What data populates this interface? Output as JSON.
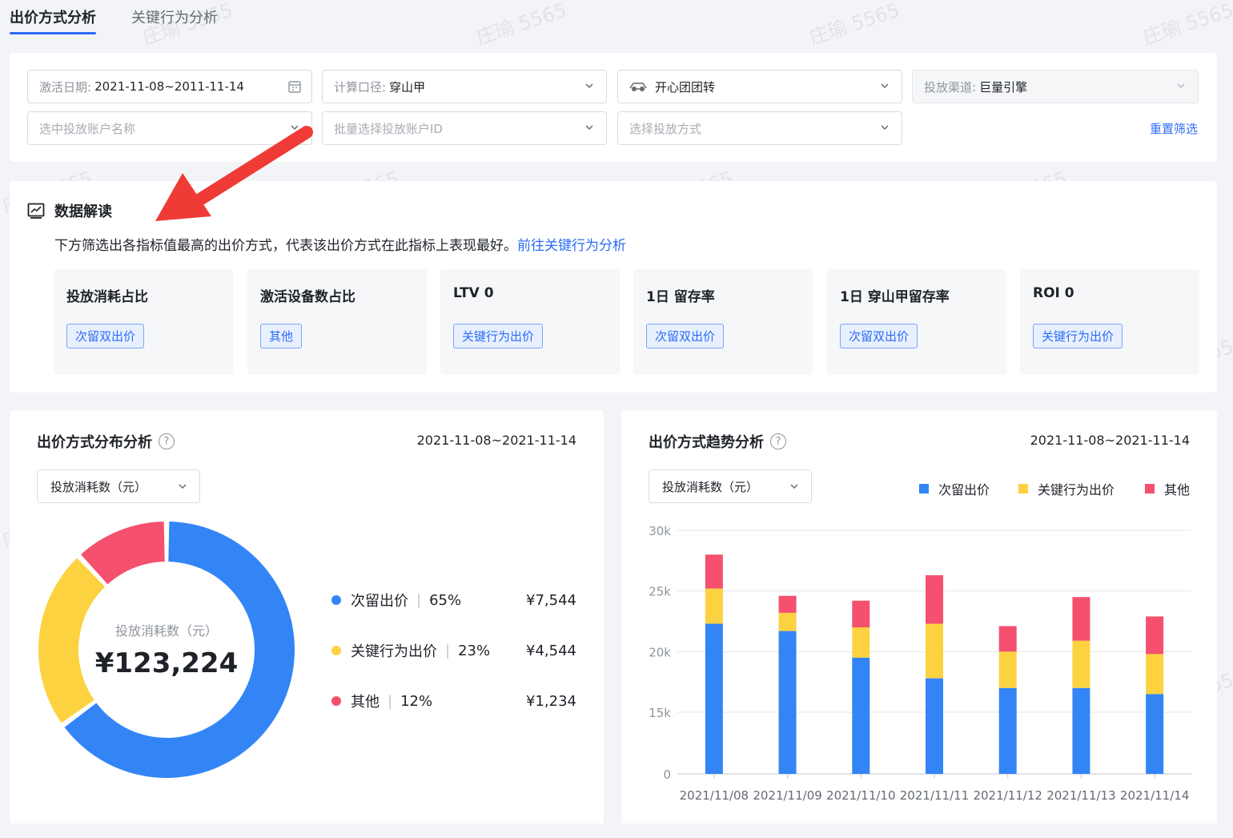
{
  "tabs": [
    {
      "label": "出价方式分析",
      "active": true
    },
    {
      "label": "关键行为分析",
      "active": false
    }
  ],
  "filters": {
    "date": {
      "label": "激活日期:",
      "value": "2021-11-08~2011-11-14"
    },
    "calc": {
      "label": "计算口径:",
      "value": "穿山甲"
    },
    "product": {
      "value": "开心团团转"
    },
    "channel": {
      "label": "投放渠道:",
      "value": "巨量引擎"
    },
    "account_name_placeholder": "选中投放账户名称",
    "account_id_placeholder": "批量选择投放账户ID",
    "bid_method_placeholder": "选择投放方式",
    "reset_label": "重置筛选"
  },
  "insight": {
    "title": "数据解读",
    "desc": "下方筛选出各指标值最高的出价方式，代表该出价方式在此指标上表现最好。",
    "link": "前往关键行为分析",
    "metrics": [
      {
        "name": "投放消耗占比",
        "tag": "次留双出价"
      },
      {
        "name": "激活设备数占比",
        "tag": "其他"
      },
      {
        "name": "LTV 0",
        "tag": "关键行为出价"
      },
      {
        "name": "1日 留存率",
        "tag": "次留双出价"
      },
      {
        "name": "1日 穿山甲留存率",
        "tag": "次留双出价"
      },
      {
        "name": "ROI 0",
        "tag": "关键行为出价"
      }
    ]
  },
  "distribution": {
    "title": "出价方式分布分析",
    "date": "2021-11-08~2021-11-14",
    "select": "投放消耗数（元）",
    "center_label": "投放消耗数（元）",
    "center_value": "¥123,224",
    "legend": [
      {
        "name": "次留出价",
        "pct": "65%",
        "amount": "¥7,544",
        "color": "#3385f6"
      },
      {
        "name": "关键行为出价",
        "pct": "23%",
        "amount": "¥4,544",
        "color": "#fcd240"
      },
      {
        "name": "其他",
        "pct": "12%",
        "amount": "¥1,234",
        "color": "#f5506e"
      }
    ]
  },
  "trend": {
    "title": "出价方式趋势分析",
    "date": "2021-11-08~2021-11-14",
    "select": "投放消耗数（元）",
    "legend": [
      {
        "name": "次留出价",
        "color": "#3385f6"
      },
      {
        "name": "关键行为出价",
        "color": "#fcd240"
      },
      {
        "name": "其他",
        "color": "#f5506e"
      }
    ]
  },
  "chart_data": [
    {
      "type": "pie",
      "labels": [
        "次留出价",
        "关键行为出价",
        "其他"
      ],
      "values": [
        65,
        23,
        12
      ],
      "colors": [
        "#3385f6",
        "#fcd240",
        "#f5506e"
      ]
    },
    {
      "type": "bar",
      "stacked": true,
      "categories": [
        "2021/11/08",
        "2021/11/09",
        "2021/11/10",
        "2021/11/11",
        "2021/11/12",
        "2021/11/13",
        "2021/11/14"
      ],
      "series": [
        {
          "name": "次留出价",
          "values": [
            22300,
            21700,
            19500,
            17800,
            17000,
            17000,
            16500
          ],
          "color": "#3385f6"
        },
        {
          "name": "关键行为出价",
          "values": [
            2900,
            1500,
            2500,
            4500,
            3000,
            3900,
            3300
          ],
          "color": "#fcd240"
        },
        {
          "name": "其他",
          "values": [
            2800,
            1400,
            2200,
            4000,
            2100,
            3600,
            3100
          ],
          "color": "#f5506e"
        }
      ],
      "y_ticks": [
        "0",
        "15k",
        "20k",
        "25k",
        "30k"
      ],
      "y_tick_values": [
        0,
        15000,
        20000,
        25000,
        30000
      ],
      "legend_position": "top-right",
      "grid": true
    }
  ],
  "watermark_text": "庄瑜 5565"
}
